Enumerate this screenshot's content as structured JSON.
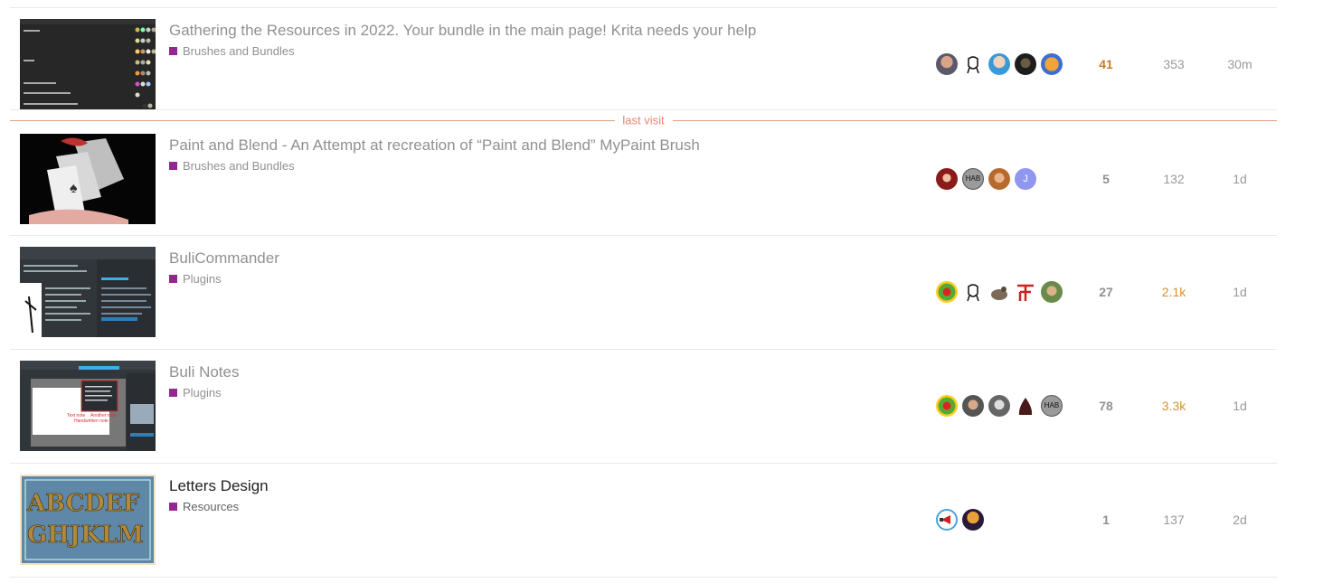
{
  "last_visit_label": "last visit",
  "topics": [
    {
      "title": "Gathering the Resources in 2022. Your bundle in the main page! Krita needs your help",
      "category": "Brushes and Bundles",
      "replies": "41",
      "views": "353",
      "activity": "30m",
      "thumb": "dark-ui-screenshot"
    },
    {
      "title": "Paint and Blend - An Attempt at recreation of “Paint and Blend” MyPaint Brush",
      "category": "Brushes and Bundles",
      "replies": "5",
      "views": "132",
      "activity": "1d",
      "thumb": "cards-painting"
    },
    {
      "title": "BuliCommander",
      "category": "Plugins",
      "replies": "27",
      "views": "2.1k",
      "activity": "1d",
      "thumb": "file-manager-screenshot"
    },
    {
      "title": "Buli Notes",
      "category": "Plugins",
      "replies": "78",
      "views": "3.3k",
      "activity": "1d",
      "thumb": "notes-screenshot"
    },
    {
      "title": "Letters Design",
      "category": "Resources",
      "replies": "1",
      "views": "137",
      "activity": "2d",
      "thumb": "letters-abcdef"
    }
  ],
  "avatar_letters": {
    "j": "J",
    "hab": "HAB"
  },
  "colors": {
    "category": "#92278f",
    "hot": "#c77a2a",
    "last_visit": "#e7876d"
  }
}
